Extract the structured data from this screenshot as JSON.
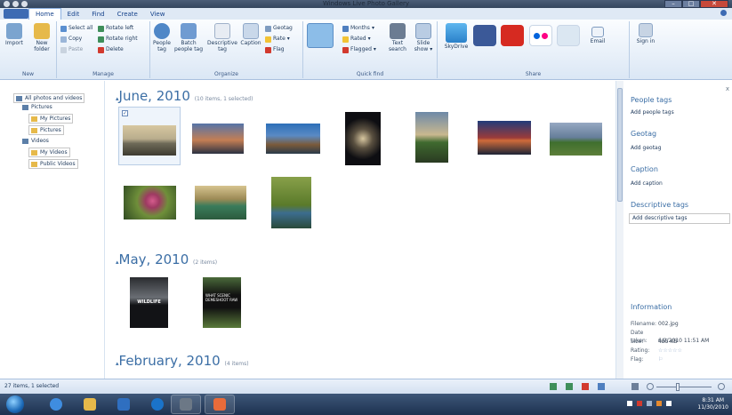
{
  "window": {
    "title": "Windows Live Photo Gallery"
  },
  "tabs": [
    "Home",
    "Edit",
    "Find",
    "Create",
    "View"
  ],
  "ribbon": {
    "groups": {
      "new": "New",
      "manage": "Manage",
      "organize": "Organize",
      "quickfind": "Quick find",
      "share": "Share"
    },
    "import": "Import",
    "new_folder": "New folder",
    "select_all": "Select all",
    "copy": "Copy",
    "paste": "Paste",
    "rotate_left": "Rotate left",
    "rotate_right": "Rotate right",
    "delete": "Delete",
    "people_tag": "People tag",
    "batch_people_tag": "Batch people tag",
    "descriptive_tag": "Descriptive tag",
    "caption": "Caption",
    "geotag": "Geotag",
    "rate": "Rate",
    "flag": "Flag",
    "months": "Months",
    "rated": "Rated",
    "flagged": "Flagged",
    "text_search": "Text search",
    "slide_show": "Slide show",
    "skydrive": "SkyDrive",
    "email": "Email",
    "sign_in": "Sign in"
  },
  "nav": {
    "items": [
      "All photos and videos",
      "Pictures",
      "My Pictures",
      "Pictures",
      "Videos",
      "My Videos",
      "Public Videos"
    ]
  },
  "groups": [
    {
      "month": "June, 2010",
      "count": "(10 items, 1 selected)"
    },
    {
      "month": "May, 2010",
      "count": "(2 items)"
    },
    {
      "month": "February, 2010",
      "count": "(4 items)"
    }
  ],
  "thumbs": {
    "wildlife": "WILDLIFE",
    "scenic_line1": "WHAT SCENIC",
    "scenic_line2": "DEMESHOOT RAW"
  },
  "info": {
    "close": "x",
    "people_tags": "People tags",
    "add_people_tags": "Add people tags",
    "geotag": "Geotag",
    "add_geotag": "Add geotag",
    "caption": "Caption",
    "add_caption": "Add caption",
    "descriptive_tags": "Descriptive tags",
    "add_descriptive_tags": "Add descriptive tags",
    "information": "Information",
    "filename_k": "Filename:",
    "filename_v": "002.jpg",
    "date_k": "Date taken:",
    "date_v": "6/2/2010 11:51 AM",
    "size_k": "Size:",
    "size_v": "485 KB",
    "rating_k": "Rating:",
    "rating_v": "☆☆☆☆☆",
    "flag_k": "Flag:",
    "flag_v": "⚐"
  },
  "status": {
    "text": "27 items, 1 selected"
  },
  "clock": {
    "time": "8:31 AM",
    "date": "11/30/2010"
  },
  "colors": {
    "accent": "#3b6ea5",
    "ribbon": "#dfe9f5",
    "taskbar": "#1d3150"
  }
}
